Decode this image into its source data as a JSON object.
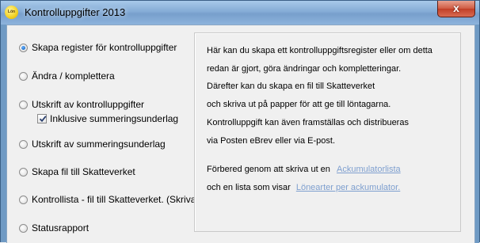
{
  "window": {
    "title": "Kontrolluppgifter 2013",
    "app_icon_text": "Lön",
    "close_symbol": "x"
  },
  "options": [
    {
      "label": "Skapa register för kontrolluppgifter",
      "checked": true
    },
    {
      "label": "Ändra / komplettera",
      "checked": false
    },
    {
      "label": "Utskrift av kontrolluppgifter",
      "checked": false
    },
    {
      "label": "Utskrift av summeringsunderlag",
      "checked": false
    },
    {
      "label": "Skapa fil till Skatteverket",
      "checked": false
    },
    {
      "label": "Kontrollista - fil till Skatteverket. (Skrivare)",
      "checked": false
    },
    {
      "label": "Statusrapport",
      "checked": false
    }
  ],
  "include_checkbox": {
    "label": "Inklusive summeringsunderlag",
    "checked": true
  },
  "info": {
    "lines": [
      "Här kan du skapa ett kontrolluppgiftsregister eller om detta",
      "redan är gjort, göra ändringar och kompletteringar.",
      "Därefter kan du skapa en fil till Skatteverket",
      "och skriva ut på papper för att ge till löntagarna.",
      "Kontrolluppgift kan även framställas och distribueras",
      "via Posten eBrev eller via E-post."
    ],
    "prep_text": "Förbered genom att skriva ut en",
    "prep_link": "Ackumulatorlista",
    "list_text": "och en lista som visar",
    "list_link": "Lönearter per ackumulator."
  },
  "colors": {
    "link": "#7e9fcf",
    "title_bar": "#85acd6",
    "close_button": "#c13f27"
  }
}
